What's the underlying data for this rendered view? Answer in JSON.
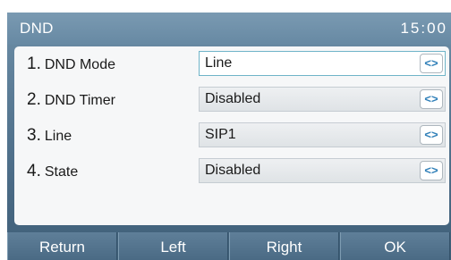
{
  "header": {
    "title": "DND",
    "time": "15:00"
  },
  "rows": [
    {
      "number": "1.",
      "label": "DND Mode",
      "value": "Line",
      "control_icon": "left-right-arrows-icon"
    },
    {
      "number": "2.",
      "label": "DND Timer",
      "value": "Disabled",
      "control_icon": "left-right-arrows-icon"
    },
    {
      "number": "3.",
      "label": "Line",
      "value": "SIP1",
      "control_icon": "left-right-arrows-icon"
    },
    {
      "number": "4.",
      "label": "State",
      "value": "Disabled",
      "control_icon": "left-right-arrows-icon"
    }
  ],
  "softkeys": {
    "return": "Return",
    "left": "Left",
    "right": "Right",
    "ok": "OK"
  },
  "colors": {
    "header_bg": "#6789a3",
    "active_field_border": "#6fb4c8",
    "arrow_color": "#2f7fb8"
  }
}
